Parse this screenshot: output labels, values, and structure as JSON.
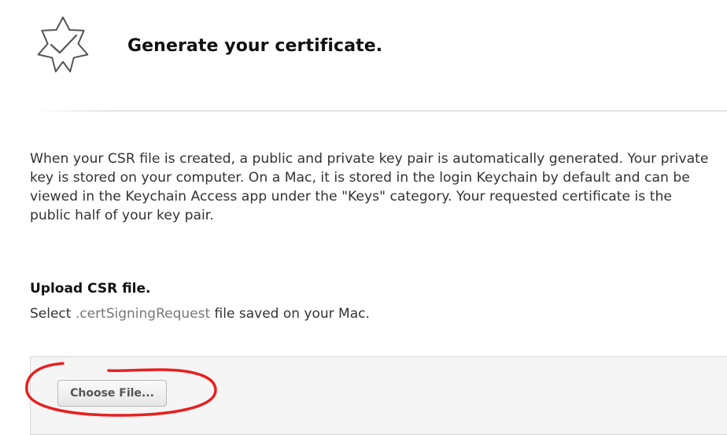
{
  "header": {
    "icon": "certificate-badge-check-icon",
    "title": "Generate your certificate."
  },
  "description": "When your CSR file is created, a public and private key pair is automatically generated. Your private key is stored on your computer. On a Mac, it is stored in the login Keychain by default and can be viewed in the Keychain Access app under the \"Keys\" category. Your requested certificate is the public half of your key pair.",
  "upload": {
    "title": "Upload CSR file.",
    "instruction_prefix": "Select ",
    "instruction_extension": ".certSigningRequest",
    "instruction_suffix": " file saved on your Mac.",
    "button_label": "Choose File..."
  },
  "colors": {
    "annotation": "#e8201f",
    "icon_stroke": "#555555",
    "panel_background": "#f5f5f5"
  }
}
